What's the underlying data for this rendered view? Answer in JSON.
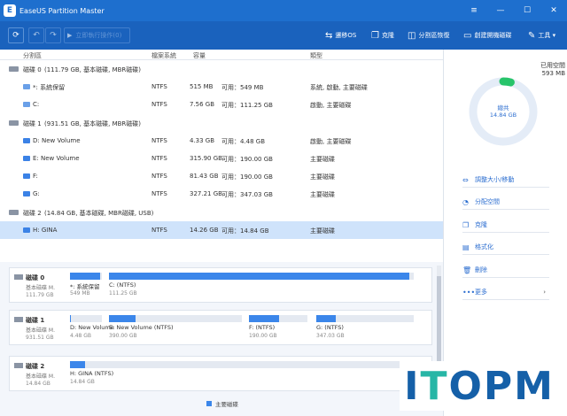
{
  "window": {
    "title": "EaseUS Partition Master",
    "logo_letter": "E",
    "menu_glyph": "≡",
    "min_glyph": "—",
    "max_glyph": "☐",
    "close_glyph": "✕"
  },
  "toolbar": {
    "refresh_glyph": "⟳",
    "undo_glyph": "↶",
    "redo_glyph": "↷",
    "pending_glyph": "▶",
    "pending_label": "立即執行操作(0)",
    "tools": [
      {
        "label": "遷移OS",
        "icon": "⇆"
      },
      {
        "label": "克隆",
        "icon": "❐"
      },
      {
        "label": "分割區恢復",
        "icon": "◫"
      },
      {
        "label": "創建開機磁碟",
        "icon": "▭"
      },
      {
        "label": "工具 ▾",
        "icon": "✎"
      }
    ]
  },
  "table": {
    "headers": [
      "分割區",
      "檔案系統",
      "容量",
      "類型"
    ],
    "rows": [
      {
        "kind": "disk",
        "name": "磁碟 0",
        "detail": "(111.79 GB, 基本磁碟, MBR磁碟)"
      },
      {
        "kind": "part",
        "sys": true,
        "name": "*: 系統保留",
        "fs": "NTFS",
        "used": "515 MB",
        "free": "可用：549 MB",
        "type": "系統, 啟動, 主要磁碟"
      },
      {
        "kind": "part",
        "sys": true,
        "name": "C:",
        "fs": "NTFS",
        "used": "7.56 GB",
        "free": "可用：111.25 GB",
        "type": "啟動, 主要磁碟"
      },
      {
        "kind": "disk",
        "name": "磁碟 1",
        "detail": "(931.51 GB, 基本磁碟, MBR磁碟)"
      },
      {
        "kind": "part",
        "name": "D: New Volume",
        "fs": "NTFS",
        "used": "4.33 GB",
        "free": "可用：4.48 GB",
        "type": "啟動, 主要磁碟"
      },
      {
        "kind": "part",
        "name": "E: New Volume",
        "fs": "NTFS",
        "used": "315.90 GB",
        "free": "可用：190.00 GB",
        "type": "主要磁碟"
      },
      {
        "kind": "part",
        "name": "F:",
        "fs": "NTFS",
        "used": "81.43 GB",
        "free": "可用：190.00 GB",
        "type": "主要磁碟"
      },
      {
        "kind": "part",
        "name": "G:",
        "fs": "NTFS",
        "used": "327.21 GB",
        "free": "可用：347.03 GB",
        "type": "主要磁碟"
      },
      {
        "kind": "disk",
        "name": "磁碟 2",
        "detail": "(14.84 GB, 基本磁碟, MBR磁碟, USB)"
      },
      {
        "kind": "part",
        "selected": true,
        "name": "H: GINA",
        "fs": "NTFS",
        "used": "14.26 GB",
        "free": "可用：14.84 GB",
        "type": "主要磁碟"
      }
    ]
  },
  "right_panel": {
    "free_label": "已用空間",
    "free_value": "593 MB",
    "total_label": "總共",
    "total_value": "14.84 GB",
    "used_fraction": 0.04,
    "actions": [
      {
        "label": "調整大小/移動",
        "icon": "⇔"
      },
      {
        "label": "分配空間",
        "icon": "◔"
      },
      {
        "label": "克隆",
        "icon": "❐"
      },
      {
        "label": "格式化",
        "icon": "▤"
      },
      {
        "label": "刪除",
        "icon": "🗑"
      },
      {
        "label": "更多",
        "icon": "•••",
        "chevron": "›"
      }
    ]
  },
  "maps": [
    {
      "name": "磁碟 0",
      "type": "基本磁碟 M.",
      "size": "111.79 GB",
      "segments": [
        {
          "label": "*: 系統保留",
          "size": "549 MB",
          "fill": 0.94
        },
        {
          "label": "C: (NTFS)",
          "size": "111.25 GB",
          "fill": 0.985
        }
      ]
    },
    {
      "name": "磁碟 1",
      "type": "基本磁碟 M.",
      "size": "931.51 GB",
      "segments": [
        {
          "label": "D: New Volume",
          "size": "4.48 GB",
          "fill": 0.04
        },
        {
          "label": "E: New Volume (NTFS)",
          "size": "390.00 GB",
          "fill": 0.2
        },
        {
          "label": "F: (NTFS)",
          "size": "190.00 GB",
          "fill": 0.52
        },
        {
          "label": "G: (NTFS)",
          "size": "347.03 GB",
          "fill": 0.2
        }
      ]
    },
    {
      "name": "磁碟 2",
      "type": "基本磁碟 M.",
      "size": "14.84 GB",
      "segments": [
        {
          "label": "H: GINA (NTFS)",
          "size": "14.84 GB",
          "fill": 0.045
        }
      ]
    }
  ],
  "legend": {
    "label": "主要磁碟"
  },
  "watermark": {
    "text": "ITOPM"
  },
  "colors": {
    "titlebar": "#1e6fce",
    "toolbar": "#1a62bd",
    "primary": "#3b86ea",
    "selected_row": "#cfe3fb",
    "accent_green": "#27c46a",
    "donut_ring": "#e4ecf7"
  }
}
